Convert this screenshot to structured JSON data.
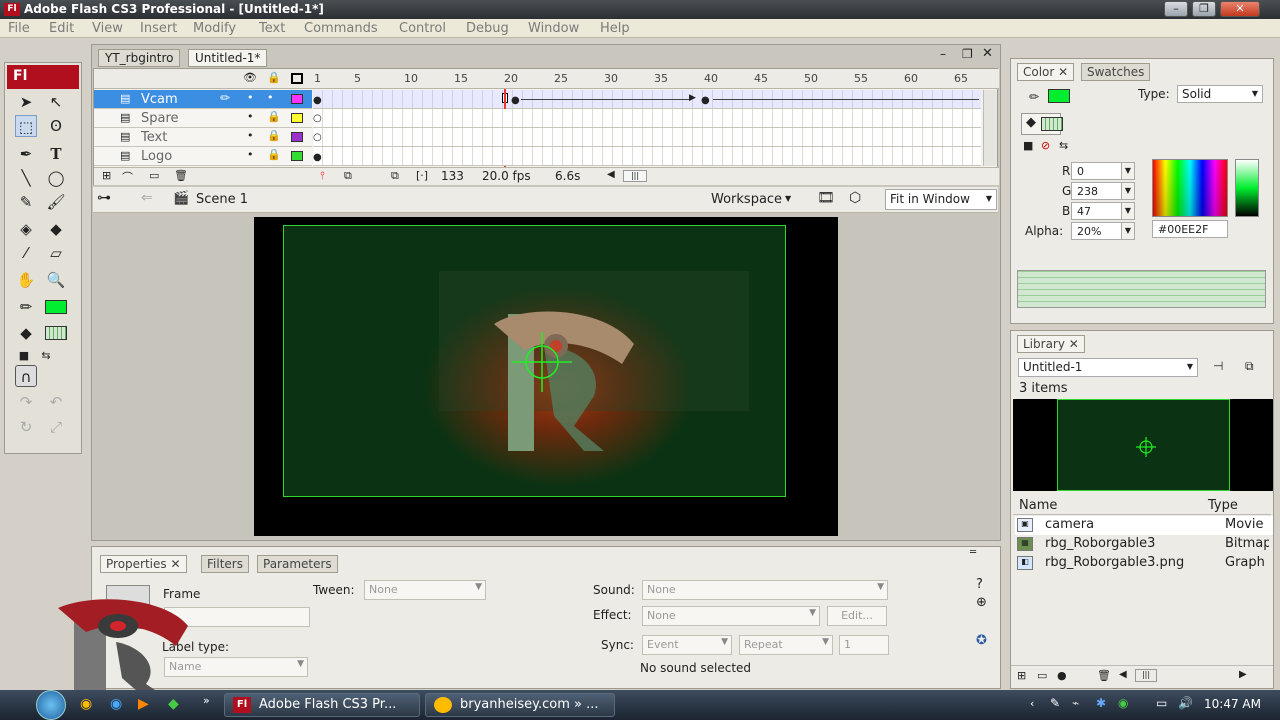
{
  "window": {
    "title": "Adobe Flash CS3 Professional - [Untitled-1*]",
    "app_icon": "Fl"
  },
  "menu": [
    "File",
    "Edit",
    "View",
    "Insert",
    "Modify",
    "Text",
    "Commands",
    "Control",
    "Debug",
    "Window",
    "Help"
  ],
  "tools": {
    "header": "Fl"
  },
  "document": {
    "tabs": [
      "YT_rbgintro",
      "Untitled-1*"
    ],
    "timeline": {
      "ruler": [
        "1",
        "5",
        "10",
        "15",
        "20",
        "25",
        "30",
        "35",
        "40",
        "45",
        "50",
        "55",
        "60",
        "65"
      ],
      "layers": [
        {
          "name": "Vcam",
          "color": "#ff33ff"
        },
        {
          "name": "Spare",
          "color": "#ffff33"
        },
        {
          "name": "Text",
          "color": "#9933cc"
        },
        {
          "name": "Logo",
          "color": "#33dd33"
        }
      ],
      "status": {
        "frame": "133",
        "fps": "20.0 fps",
        "time": "6.6s"
      }
    },
    "editbar": {
      "scene": "Scene 1",
      "workspace": "Workspace",
      "zoom": "Fit in Window"
    }
  },
  "properties": {
    "tabs": [
      "Properties",
      "Filters",
      "Parameters"
    ],
    "frame_label": "Frame",
    "tween_label": "Tween:",
    "tween_value": "None",
    "label_type_label": "Label type:",
    "label_type_value": "Name",
    "sound_label": "Sound:",
    "sound_value": "None",
    "effect_label": "Effect:",
    "effect_value": "None",
    "edit_button": "Edit...",
    "sync_label": "Sync:",
    "sync_value": "Event",
    "repeat_value": "Repeat",
    "repeat_count": "1",
    "sound_status": "No sound selected"
  },
  "color_panel": {
    "tabs": [
      "Color",
      "Swatches"
    ],
    "type_label": "Type:",
    "type_value": "Solid",
    "r_label": "R:",
    "r": "0",
    "g_label": "G:",
    "g": "238",
    "b_label": "B:",
    "b": "47",
    "alpha_label": "Alpha:",
    "alpha": "20%",
    "hex": "#00EE2F",
    "fill_color": "#00ee2f"
  },
  "library": {
    "tab": "Library",
    "document": "Untitled-1",
    "count": "3 items",
    "columns": [
      "Name",
      "Type"
    ],
    "items": [
      {
        "name": "camera",
        "type": "Movie"
      },
      {
        "name": "rbg_Roborgable3",
        "type": "Bitmap"
      },
      {
        "name": "rbg_Roborgable3.png",
        "type": "Graph"
      }
    ]
  },
  "taskbar": {
    "items": [
      "Adobe Flash CS3 Pr...",
      "bryanheisey.com » ..."
    ],
    "clock": "10:47 AM"
  }
}
